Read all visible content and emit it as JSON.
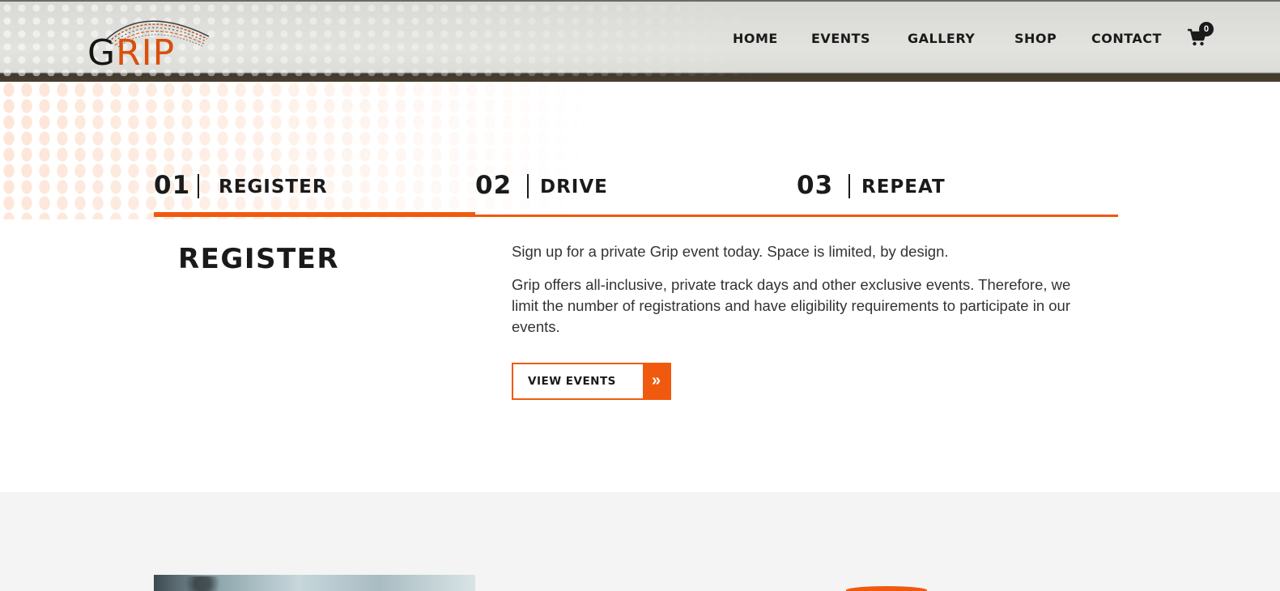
{
  "brand": {
    "logo_g": "G",
    "logo_rip": "RIP",
    "logo_alt": "GRIP",
    "accent_color": "#f05a0e"
  },
  "nav": {
    "items": [
      {
        "label": "HOME"
      },
      {
        "label": "EVENTS"
      },
      {
        "label": "GALLERY"
      },
      {
        "label": "SHOP"
      },
      {
        "label": "CONTACT"
      }
    ],
    "cart_icon": "cart-icon",
    "cart_count": "0"
  },
  "steps": {
    "tabs": [
      {
        "number": "01",
        "label": "REGISTER",
        "active": true
      },
      {
        "number": "02",
        "label": "DRIVE",
        "active": false
      },
      {
        "number": "03",
        "label": "REPEAT",
        "active": false
      }
    ]
  },
  "panel": {
    "title": "REGISTER",
    "paragraph_1": "Sign up for a private Grip event today. Space is limited, by design.",
    "paragraph_2": "Grip offers all-inclusive, private track days and other exclusive events. Therefore, we limit the number of registrations and have eligibility requirements to participate in our events.",
    "button_label": "VIEW EVENTS",
    "button_icon": "double-chevron-right-icon"
  }
}
